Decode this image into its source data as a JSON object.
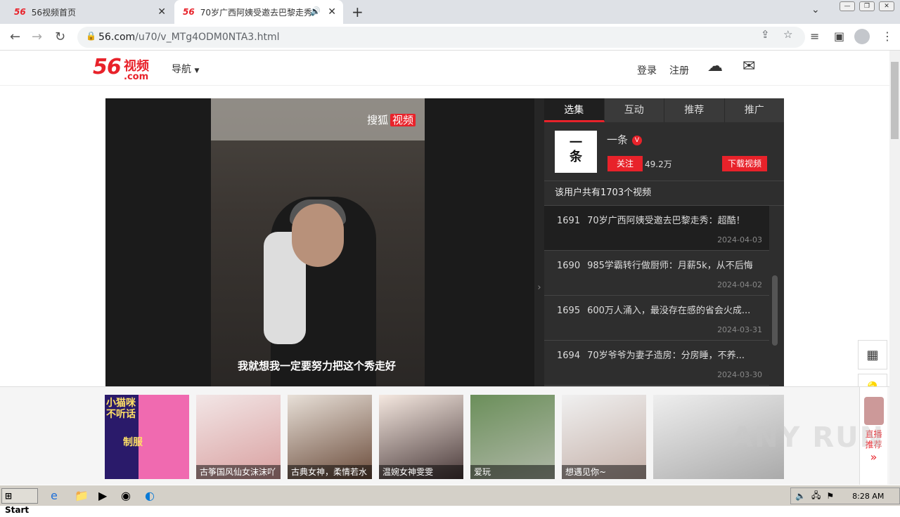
{
  "browser": {
    "tabs": [
      {
        "favicon": "56",
        "title": "56视频首页"
      },
      {
        "favicon": "56",
        "title": "70岁广西阿姨受邀去巴黎走秀"
      }
    ],
    "url_domain": "56.com",
    "url_path": "/u70/v_MTg4ODM0NTA3.html",
    "icons": [
      "back-icon",
      "forward-icon",
      "reload-icon",
      "lock-icon",
      "share-icon",
      "star-icon",
      "media-icon",
      "sidepanel-icon",
      "profile-icon",
      "menu-icon"
    ]
  },
  "site": {
    "logo_num": "56",
    "logo_text": "视频",
    "logo_sub": ".com",
    "nav_label": "导航",
    "login": "登录",
    "register": "注册"
  },
  "player": {
    "watermark_a": "搜狐",
    "watermark_b": "视频",
    "subtitle": "我就想我一定要努力把这个秀走好",
    "expand": "›"
  },
  "panel": {
    "tabs": [
      "选集",
      "互动",
      "推荐",
      "推广"
    ],
    "uploader_logo": "一\n条",
    "uploader_name": "一条",
    "follow_label": "关注",
    "fans": "49.2万",
    "download_label": "下载视频",
    "video_count": "该用户共有1703个视频",
    "videos": [
      {
        "no": "1691",
        "title": "70岁广西阿姨受邀去巴黎走秀：超酷！",
        "date": "2024-04-03"
      },
      {
        "no": "1690",
        "title": "985学霸转行做厨师：月薪5k，从不后悔",
        "date": "2024-04-02"
      },
      {
        "no": "1695",
        "title": "600万人涌入，最没存在感的省会火成...",
        "date": "2024-03-31"
      },
      {
        "no": "1694",
        "title": "70岁爷爷为妻子造房：分房睡，不养...",
        "date": "2024-03-30"
      }
    ]
  },
  "recommend": {
    "promo_text_a": "小猫咪不听话",
    "promo_text_b": "制服",
    "items": [
      {
        "caption": ""
      },
      {
        "caption": "古筝国风仙女沫沫吖"
      },
      {
        "caption": "古典女神，柔情若水"
      },
      {
        "caption": "温婉女神雯雯"
      },
      {
        "caption": "爱玩"
      },
      {
        "caption": "想遇见你~"
      },
      {
        "caption": ""
      }
    ],
    "live_label": "直播推荐",
    "live_arrow": "»"
  },
  "watermark": "ANY RUN",
  "taskbar": {
    "start": "Start",
    "clock": "8:28 AM"
  }
}
